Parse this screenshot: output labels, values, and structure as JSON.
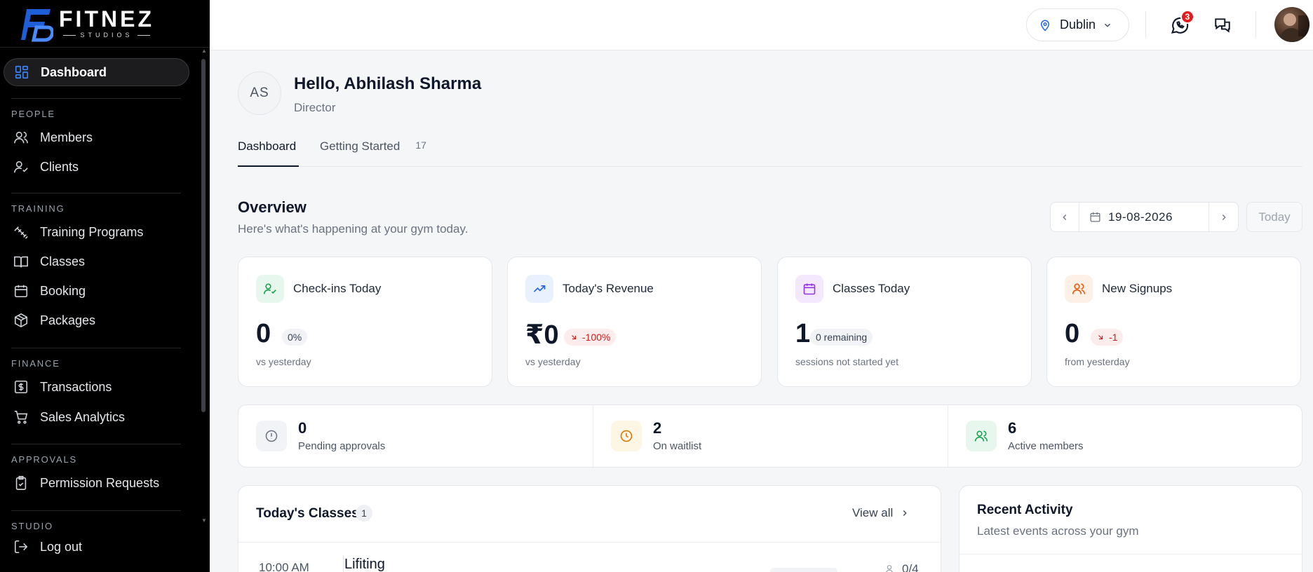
{
  "brand": {
    "name": "FITNEZ",
    "tagline": "STUDIOS"
  },
  "sidebar": {
    "active": {
      "label": "Dashboard"
    },
    "sections": [
      {
        "title": "PEOPLE",
        "items": [
          {
            "label": "Members"
          },
          {
            "label": "Clients"
          }
        ]
      },
      {
        "title": "TRAINING",
        "items": [
          {
            "label": "Training Programs"
          },
          {
            "label": "Classes"
          },
          {
            "label": "Booking"
          },
          {
            "label": "Packages"
          }
        ]
      },
      {
        "title": "FINANCE",
        "items": [
          {
            "label": "Transactions"
          },
          {
            "label": "Sales Analytics"
          }
        ]
      },
      {
        "title": "APPROVALS",
        "items": [
          {
            "label": "Permission Requests"
          }
        ]
      },
      {
        "title": "STUDIO",
        "items": []
      }
    ],
    "logout": "Log out"
  },
  "topbar": {
    "location": "Dublin",
    "whatsapp_badge": "3"
  },
  "user": {
    "initials": "AS",
    "greeting": "Hello, Abhilash Sharma",
    "role": "Director"
  },
  "tabs": [
    {
      "label": "Dashboard",
      "active": true
    },
    {
      "label": "Getting Started",
      "count": "17"
    }
  ],
  "overview": {
    "title": "Overview",
    "subtitle": "Here's what's happening at your gym today.",
    "date": "19-08-2026",
    "today_label": "Today"
  },
  "cards": [
    {
      "label": "Check-ins Today",
      "value": "0",
      "pill": "0%",
      "note": "vs yesterday",
      "icon": "user-check-icon",
      "color": "#16a34a",
      "bg": "#e8f7ee"
    },
    {
      "label": "Today's Revenue",
      "value": "₹0",
      "pill": "-100%",
      "note": "vs yesterday",
      "icon": "trending-up-icon",
      "color": "#2563eb",
      "bg": "#eaf1fe"
    },
    {
      "label": "Classes Today",
      "value": "1",
      "pill": "0 remaining",
      "note": "sessions not started yet",
      "icon": "calendar-icon",
      "color": "#9333ea",
      "bg": "#f3e8fd"
    },
    {
      "label": "New Signups",
      "value": "0",
      "pill": "-1",
      "note": "from yesterday",
      "icon": "users-icon",
      "color": "#ea580c",
      "bg": "#fdf0e6"
    }
  ],
  "stats": [
    {
      "value": "0",
      "label": "Pending approvals",
      "icon": "info-icon",
      "color": "#6b7280",
      "bg": "#f1f3f6"
    },
    {
      "value": "2",
      "label": "On waitlist",
      "icon": "clock-icon",
      "color": "#d97706",
      "bg": "#fef6e4"
    },
    {
      "value": "6",
      "label": "Active members",
      "icon": "users-icon",
      "color": "#16a34a",
      "bg": "#e8f7ee"
    }
  ],
  "todays_classes": {
    "title": "Today's Classes",
    "count": "1",
    "view_all": "View all",
    "rows": [
      {
        "time": "10:00 AM",
        "name": "Lifiting",
        "capacity": "0/4"
      }
    ]
  },
  "recent_activity": {
    "title": "Recent Activity",
    "subtitle": "Latest events across your gym"
  }
}
